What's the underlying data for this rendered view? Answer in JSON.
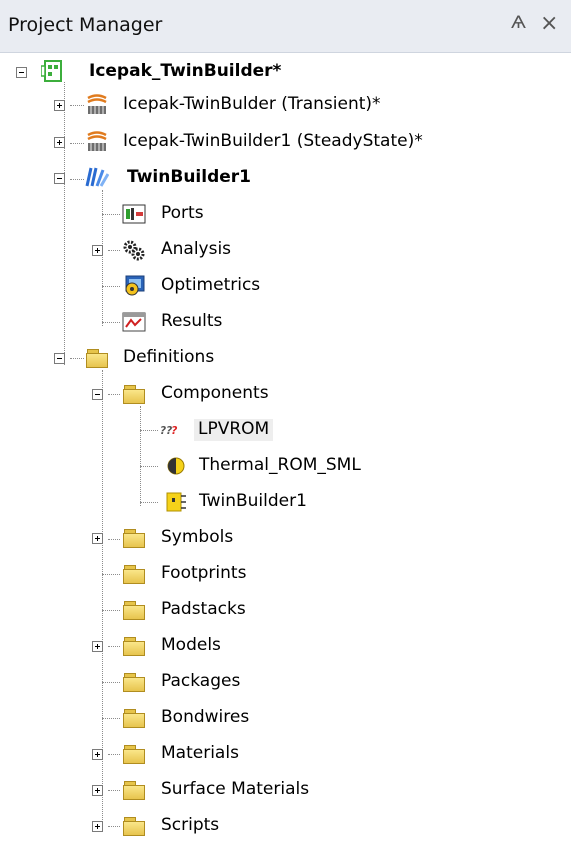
{
  "panel": {
    "title": "Project Manager",
    "pin_glyph": "Ѧ",
    "close_glyph": "×"
  },
  "tree": {
    "project": "Icepak_TwinBuilder*",
    "design_transient": "Icepak-TwinBulder (Transient)*",
    "design_steady": "Icepak-TwinBuilder1 (SteadyState)*",
    "twinbuilder": "TwinBuilder1",
    "ports": "Ports",
    "analysis": "Analysis",
    "optimetrics": "Optimetrics",
    "results": "Results",
    "definitions": "Definitions",
    "components": "Components",
    "lpvrom": "LPVROM",
    "thermal_rom": "Thermal_ROM_SML",
    "twinbuilder_comp": "TwinBuilder1",
    "symbols": "Symbols",
    "footprints": "Footprints",
    "padstacks": "Padstacks",
    "models": "Models",
    "packages": "Packages",
    "bondwires": "Bondwires",
    "materials": "Materials",
    "surface_materials": "Surface Materials",
    "scripts": "Scripts"
  },
  "colors": {
    "header_bg": "#e9ecf2",
    "folder": "#f2d466",
    "project_icon": "#3cae3c",
    "twinbuilder_icon": "#2a6bd1"
  }
}
